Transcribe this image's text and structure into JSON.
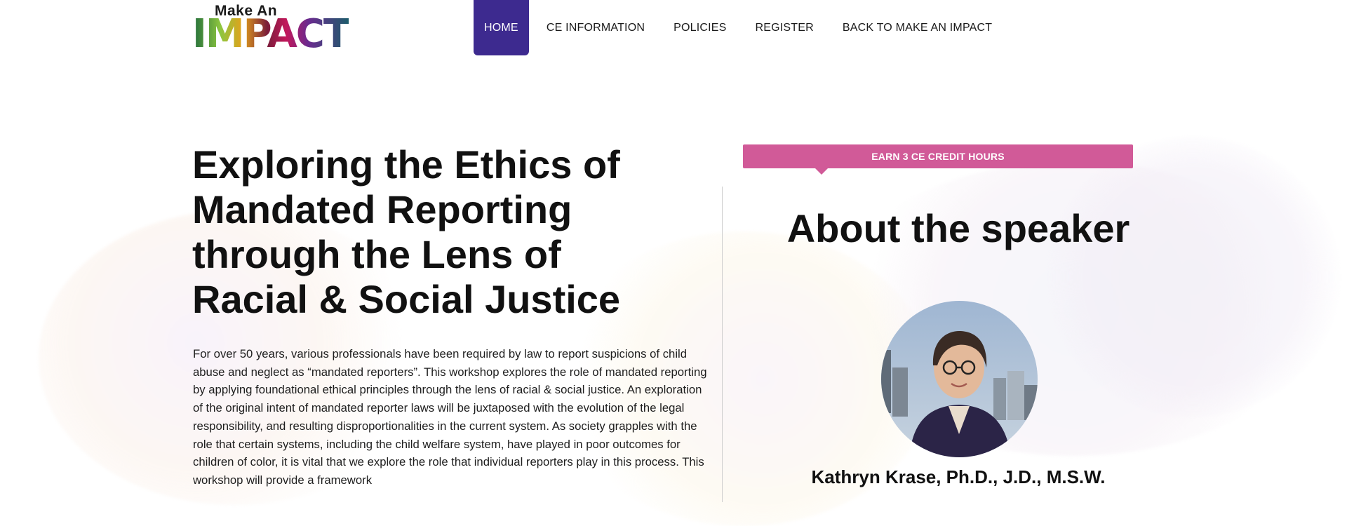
{
  "brand": {
    "logo_small": "Make An",
    "logo_big": "IMPACT"
  },
  "nav": {
    "items": [
      {
        "label": "HOME",
        "active": true
      },
      {
        "label": "CE INFORMATION",
        "active": false
      },
      {
        "label": "POLICIES",
        "active": false
      },
      {
        "label": "REGISTER",
        "active": false
      },
      {
        "label": "BACK TO MAKE AN IMPACT",
        "active": false
      }
    ]
  },
  "main": {
    "title": "Exploring the Ethics of Mandated Reporting through the Lens of Racial & Social Justice",
    "description": "For over 50 years, various professionals have been required by law to report suspicions of child abuse and neglect as “mandated reporters”. This workshop explores the role of mandated reporting by applying foundational ethical principles through the lens of racial & social justice. An exploration of the original intent of mandated reporter laws will be juxtaposed with the evolution of the legal responsibility, and resulting disproportionalities in the current system. As society grapples with the role that certain systems, including the child welfare system, have played in poor outcomes for children of color, it is vital that we explore the role that individual reporters play in this process. This workshop will provide a framework"
  },
  "sidebar": {
    "badge": "EARN 3 CE CREDIT HOURS",
    "heading": "About the speaker",
    "speaker_name": "Kathryn Krase, Ph.D., J.D., M.S.W."
  },
  "colors": {
    "nav_active_bg": "#3d2a8f",
    "badge_bg": "#d15a98",
    "text": "#111111"
  }
}
